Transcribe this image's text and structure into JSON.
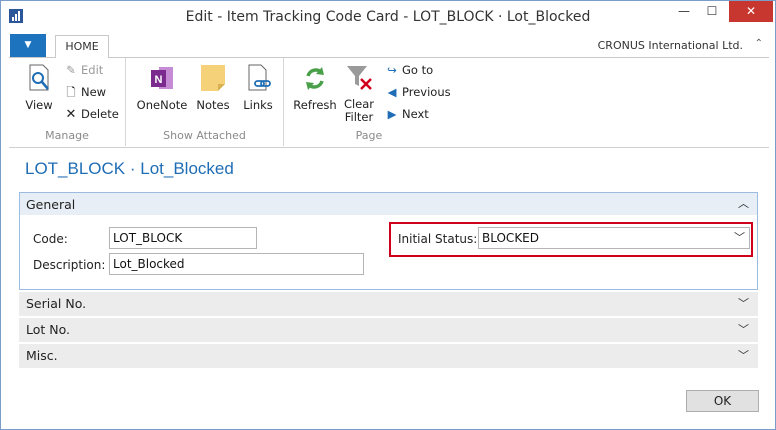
{
  "window": {
    "title": "Edit - Item Tracking Code Card - LOT_BLOCK · Lot_Blocked",
    "minimize": "—",
    "maximize": "☐",
    "close": "✕"
  },
  "ribbon": {
    "file_menu": "▼",
    "home_tab": "HOME",
    "company": "CRONUS International Ltd.",
    "minimize_ribbon": "⌃",
    "groups": {
      "manage": {
        "label": "Manage",
        "view": "View",
        "edit": "Edit",
        "new": "New",
        "delete": "Delete"
      },
      "show_attached": {
        "label": "Show Attached",
        "onenote": "OneNote",
        "notes": "Notes",
        "links": "Links"
      },
      "page": {
        "label": "Page",
        "refresh": "Refresh",
        "clear_filter_1": "Clear",
        "clear_filter_2": "Filter",
        "goto": "Go to",
        "previous": "Previous",
        "next": "Next"
      }
    }
  },
  "page": {
    "title": "LOT_BLOCK · Lot_Blocked"
  },
  "general": {
    "header": "General",
    "code_label": "Code:",
    "code_value": "LOT_BLOCK",
    "description_label": "Description:",
    "description_value": "Lot_Blocked",
    "initial_status_label": "Initial Status:",
    "initial_status_value": "BLOCKED"
  },
  "fasttabs": [
    "Serial No.",
    "Lot No.",
    "Misc."
  ],
  "buttons": {
    "ok": "OK"
  },
  "colors": {
    "accent": "#1f6db5",
    "highlight_border": "#d0021b",
    "file_button": "#1e73be"
  }
}
